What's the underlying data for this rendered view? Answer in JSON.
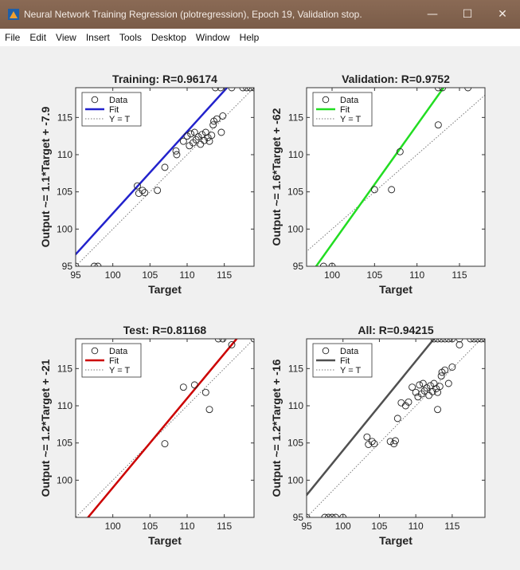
{
  "window": {
    "title": "Neural Network Training Regression (plotregression), Epoch 19, Validation stop.",
    "minimize": "—",
    "maximize": "☐",
    "close": "✕"
  },
  "menu": [
    "File",
    "Edit",
    "View",
    "Insert",
    "Tools",
    "Desktop",
    "Window",
    "Help"
  ],
  "chart_data": [
    {
      "type": "scatter",
      "title": "Training: R=0.96174",
      "xlabel": "Target",
      "ylabel": "Output ~= 1.1*Target + -7.9",
      "xlim": [
        95,
        119
      ],
      "ylim": [
        95,
        119
      ],
      "xticks": [
        95,
        100,
        105,
        110,
        115
      ],
      "yticks": [
        95,
        100,
        105,
        110,
        115
      ],
      "fit_color": "#2222cc",
      "fit": {
        "slope": 1.1,
        "intercept": -7.9
      },
      "legend": [
        "Data",
        "Fit",
        "Y = T"
      ],
      "points": [
        [
          95,
          95
        ],
        [
          97.5,
          95
        ],
        [
          98,
          95
        ],
        [
          103.3,
          105.8
        ],
        [
          103.5,
          104.8
        ],
        [
          104,
          105.2
        ],
        [
          104.3,
          104.9
        ],
        [
          106,
          105.2
        ],
        [
          107,
          108.3
        ],
        [
          108.5,
          110.5
        ],
        [
          108.6,
          110
        ],
        [
          109.5,
          111.8
        ],
        [
          110,
          112.5
        ],
        [
          110.3,
          111.2
        ],
        [
          110.5,
          112.8
        ],
        [
          110.8,
          111.6
        ],
        [
          111,
          113
        ],
        [
          111.2,
          112
        ],
        [
          111.5,
          112.4
        ],
        [
          111.8,
          111.4
        ],
        [
          112,
          112.7
        ],
        [
          112.3,
          111.9
        ],
        [
          112.5,
          113
        ],
        [
          112.8,
          112.3
        ],
        [
          113,
          111.8
        ],
        [
          113.3,
          112.6
        ],
        [
          113.5,
          114
        ],
        [
          113.6,
          114.5
        ],
        [
          114,
          114.8
        ],
        [
          114.8,
          115.2
        ],
        [
          114.6,
          113
        ],
        [
          113.8,
          119
        ],
        [
          114.5,
          119
        ],
        [
          116,
          119
        ],
        [
          117.5,
          119
        ],
        [
          118,
          119
        ],
        [
          118.5,
          119
        ],
        [
          119,
          119
        ]
      ]
    },
    {
      "type": "scatter",
      "title": "Validation: R=0.9752",
      "xlabel": "Target",
      "ylabel": "Output ~= 1.6*Target + -62",
      "xlim": [
        97,
        118
      ],
      "ylim": [
        95,
        119
      ],
      "xticks": [
        100,
        105,
        110,
        115
      ],
      "yticks": [
        95,
        100,
        105,
        110,
        115
      ],
      "fit_color": "#22dd22",
      "fit": {
        "slope": 1.6,
        "intercept": -62
      },
      "legend": [
        "Data",
        "Fit",
        "Y = T"
      ],
      "points": [
        [
          99,
          95
        ],
        [
          100,
          95
        ],
        [
          105,
          105.3
        ],
        [
          107,
          105.3
        ],
        [
          108,
          110.4
        ],
        [
          112.5,
          114
        ],
        [
          112.5,
          119
        ],
        [
          113,
          119
        ],
        [
          116,
          119
        ]
      ]
    },
    {
      "type": "scatter",
      "title": "Test: R=0.81168",
      "xlabel": "Target",
      "ylabel": "Output ~= 1.2*Target + -21",
      "xlim": [
        95,
        119
      ],
      "ylim": [
        95,
        119
      ],
      "xticks": [
        100,
        105,
        110,
        115
      ],
      "yticks": [
        100,
        105,
        110,
        115
      ],
      "fit_color": "#cc0000",
      "fit": {
        "slope": 1.2,
        "intercept": -21
      },
      "legend": [
        "Data",
        "Fit",
        "Y = T"
      ],
      "points": [
        [
          107,
          104.9
        ],
        [
          109.5,
          112.5
        ],
        [
          111,
          112.8
        ],
        [
          112.5,
          111.8
        ],
        [
          113,
          109.5
        ],
        [
          114.2,
          119
        ],
        [
          114.8,
          119
        ],
        [
          116,
          118.2
        ],
        [
          119,
          119
        ]
      ]
    },
    {
      "type": "scatter",
      "title": "All: R=0.94215",
      "xlabel": "Target",
      "ylabel": "Output ~= 1.2*Target + -16",
      "xlim": [
        95,
        119.5
      ],
      "ylim": [
        95,
        119
      ],
      "xticks": [
        95,
        100,
        105,
        110,
        115
      ],
      "yticks": [
        95,
        100,
        105,
        110,
        115
      ],
      "fit_color": "#505050",
      "fit": {
        "slope": 1.2,
        "intercept": -16
      },
      "legend": [
        "Data",
        "Fit",
        "Y = T"
      ],
      "points": [
        [
          95,
          95
        ],
        [
          97.5,
          95
        ],
        [
          98,
          95
        ],
        [
          98.5,
          95
        ],
        [
          99,
          95
        ],
        [
          100,
          95
        ],
        [
          103.3,
          105.8
        ],
        [
          103.5,
          104.8
        ],
        [
          104,
          105.2
        ],
        [
          104.3,
          104.9
        ],
        [
          106.5,
          105.2
        ],
        [
          107,
          104.9
        ],
        [
          107.2,
          105.3
        ],
        [
          107.5,
          108.3
        ],
        [
          108,
          110.4
        ],
        [
          108.6,
          110
        ],
        [
          109,
          110.5
        ],
        [
          109.5,
          112.5
        ],
        [
          110,
          111.8
        ],
        [
          110.3,
          111.2
        ],
        [
          110.5,
          112.8
        ],
        [
          110.8,
          111.6
        ],
        [
          111,
          113
        ],
        [
          111.2,
          112
        ],
        [
          111.5,
          112.4
        ],
        [
          111.8,
          111.4
        ],
        [
          112,
          112.7
        ],
        [
          112.3,
          111.9
        ],
        [
          112.5,
          113
        ],
        [
          112.8,
          112.3
        ],
        [
          113,
          111.8
        ],
        [
          113,
          109.5
        ],
        [
          113.3,
          112.6
        ],
        [
          113.5,
          114
        ],
        [
          113.6,
          114.5
        ],
        [
          114,
          114.8
        ],
        [
          114.5,
          113
        ],
        [
          115,
          115.2
        ],
        [
          116,
          118.2
        ],
        [
          112.5,
          119
        ],
        [
          113,
          119
        ],
        [
          113.5,
          119
        ],
        [
          114,
          119
        ],
        [
          114.5,
          119
        ],
        [
          115,
          119
        ],
        [
          116,
          119
        ],
        [
          117.5,
          119
        ],
        [
          118,
          119
        ],
        [
          118.5,
          119
        ],
        [
          119,
          119
        ],
        [
          119.5,
          119
        ]
      ]
    }
  ]
}
